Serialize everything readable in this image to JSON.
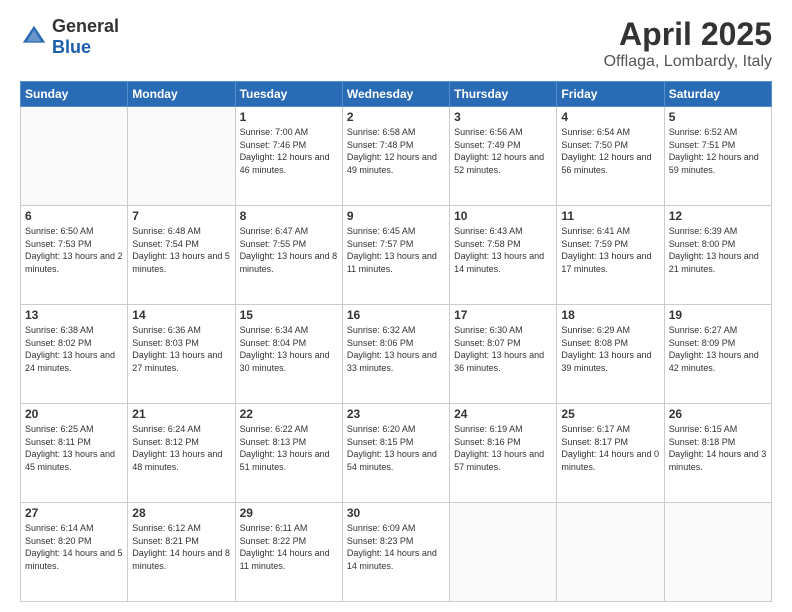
{
  "header": {
    "logo_general": "General",
    "logo_blue": "Blue",
    "month_title": "April 2025",
    "location": "Offlaga, Lombardy, Italy"
  },
  "weekdays": [
    "Sunday",
    "Monday",
    "Tuesday",
    "Wednesday",
    "Thursday",
    "Friday",
    "Saturday"
  ],
  "weeks": [
    [
      {
        "day": "",
        "sunrise": "",
        "sunset": "",
        "daylight": ""
      },
      {
        "day": "",
        "sunrise": "",
        "sunset": "",
        "daylight": ""
      },
      {
        "day": "1",
        "sunrise": "Sunrise: 7:00 AM",
        "sunset": "Sunset: 7:46 PM",
        "daylight": "Daylight: 12 hours and 46 minutes."
      },
      {
        "day": "2",
        "sunrise": "Sunrise: 6:58 AM",
        "sunset": "Sunset: 7:48 PM",
        "daylight": "Daylight: 12 hours and 49 minutes."
      },
      {
        "day": "3",
        "sunrise": "Sunrise: 6:56 AM",
        "sunset": "Sunset: 7:49 PM",
        "daylight": "Daylight: 12 hours and 52 minutes."
      },
      {
        "day": "4",
        "sunrise": "Sunrise: 6:54 AM",
        "sunset": "Sunset: 7:50 PM",
        "daylight": "Daylight: 12 hours and 56 minutes."
      },
      {
        "day": "5",
        "sunrise": "Sunrise: 6:52 AM",
        "sunset": "Sunset: 7:51 PM",
        "daylight": "Daylight: 12 hours and 59 minutes."
      }
    ],
    [
      {
        "day": "6",
        "sunrise": "Sunrise: 6:50 AM",
        "sunset": "Sunset: 7:53 PM",
        "daylight": "Daylight: 13 hours and 2 minutes."
      },
      {
        "day": "7",
        "sunrise": "Sunrise: 6:48 AM",
        "sunset": "Sunset: 7:54 PM",
        "daylight": "Daylight: 13 hours and 5 minutes."
      },
      {
        "day": "8",
        "sunrise": "Sunrise: 6:47 AM",
        "sunset": "Sunset: 7:55 PM",
        "daylight": "Daylight: 13 hours and 8 minutes."
      },
      {
        "day": "9",
        "sunrise": "Sunrise: 6:45 AM",
        "sunset": "Sunset: 7:57 PM",
        "daylight": "Daylight: 13 hours and 11 minutes."
      },
      {
        "day": "10",
        "sunrise": "Sunrise: 6:43 AM",
        "sunset": "Sunset: 7:58 PM",
        "daylight": "Daylight: 13 hours and 14 minutes."
      },
      {
        "day": "11",
        "sunrise": "Sunrise: 6:41 AM",
        "sunset": "Sunset: 7:59 PM",
        "daylight": "Daylight: 13 hours and 17 minutes."
      },
      {
        "day": "12",
        "sunrise": "Sunrise: 6:39 AM",
        "sunset": "Sunset: 8:00 PM",
        "daylight": "Daylight: 13 hours and 21 minutes."
      }
    ],
    [
      {
        "day": "13",
        "sunrise": "Sunrise: 6:38 AM",
        "sunset": "Sunset: 8:02 PM",
        "daylight": "Daylight: 13 hours and 24 minutes."
      },
      {
        "day": "14",
        "sunrise": "Sunrise: 6:36 AM",
        "sunset": "Sunset: 8:03 PM",
        "daylight": "Daylight: 13 hours and 27 minutes."
      },
      {
        "day": "15",
        "sunrise": "Sunrise: 6:34 AM",
        "sunset": "Sunset: 8:04 PM",
        "daylight": "Daylight: 13 hours and 30 minutes."
      },
      {
        "day": "16",
        "sunrise": "Sunrise: 6:32 AM",
        "sunset": "Sunset: 8:06 PM",
        "daylight": "Daylight: 13 hours and 33 minutes."
      },
      {
        "day": "17",
        "sunrise": "Sunrise: 6:30 AM",
        "sunset": "Sunset: 8:07 PM",
        "daylight": "Daylight: 13 hours and 36 minutes."
      },
      {
        "day": "18",
        "sunrise": "Sunrise: 6:29 AM",
        "sunset": "Sunset: 8:08 PM",
        "daylight": "Daylight: 13 hours and 39 minutes."
      },
      {
        "day": "19",
        "sunrise": "Sunrise: 6:27 AM",
        "sunset": "Sunset: 8:09 PM",
        "daylight": "Daylight: 13 hours and 42 minutes."
      }
    ],
    [
      {
        "day": "20",
        "sunrise": "Sunrise: 6:25 AM",
        "sunset": "Sunset: 8:11 PM",
        "daylight": "Daylight: 13 hours and 45 minutes."
      },
      {
        "day": "21",
        "sunrise": "Sunrise: 6:24 AM",
        "sunset": "Sunset: 8:12 PM",
        "daylight": "Daylight: 13 hours and 48 minutes."
      },
      {
        "day": "22",
        "sunrise": "Sunrise: 6:22 AM",
        "sunset": "Sunset: 8:13 PM",
        "daylight": "Daylight: 13 hours and 51 minutes."
      },
      {
        "day": "23",
        "sunrise": "Sunrise: 6:20 AM",
        "sunset": "Sunset: 8:15 PM",
        "daylight": "Daylight: 13 hours and 54 minutes."
      },
      {
        "day": "24",
        "sunrise": "Sunrise: 6:19 AM",
        "sunset": "Sunset: 8:16 PM",
        "daylight": "Daylight: 13 hours and 57 minutes."
      },
      {
        "day": "25",
        "sunrise": "Sunrise: 6:17 AM",
        "sunset": "Sunset: 8:17 PM",
        "daylight": "Daylight: 14 hours and 0 minutes."
      },
      {
        "day": "26",
        "sunrise": "Sunrise: 6:15 AM",
        "sunset": "Sunset: 8:18 PM",
        "daylight": "Daylight: 14 hours and 3 minutes."
      }
    ],
    [
      {
        "day": "27",
        "sunrise": "Sunrise: 6:14 AM",
        "sunset": "Sunset: 8:20 PM",
        "daylight": "Daylight: 14 hours and 5 minutes."
      },
      {
        "day": "28",
        "sunrise": "Sunrise: 6:12 AM",
        "sunset": "Sunset: 8:21 PM",
        "daylight": "Daylight: 14 hours and 8 minutes."
      },
      {
        "day": "29",
        "sunrise": "Sunrise: 6:11 AM",
        "sunset": "Sunset: 8:22 PM",
        "daylight": "Daylight: 14 hours and 11 minutes."
      },
      {
        "day": "30",
        "sunrise": "Sunrise: 6:09 AM",
        "sunset": "Sunset: 8:23 PM",
        "daylight": "Daylight: 14 hours and 14 minutes."
      },
      {
        "day": "",
        "sunrise": "",
        "sunset": "",
        "daylight": ""
      },
      {
        "day": "",
        "sunrise": "",
        "sunset": "",
        "daylight": ""
      },
      {
        "day": "",
        "sunrise": "",
        "sunset": "",
        "daylight": ""
      }
    ]
  ]
}
